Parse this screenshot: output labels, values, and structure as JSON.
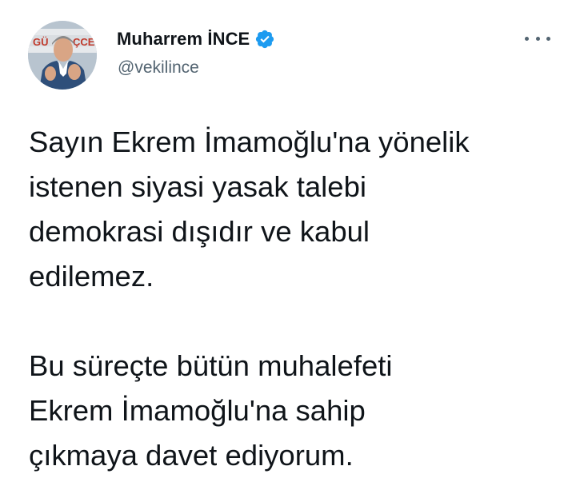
{
  "author": {
    "display_name": "Muharrem İNCE",
    "handle": "@vekilince",
    "verified": true,
    "avatar_banner_text": "GÜ ÇCE"
  },
  "icons": {
    "verified": "verified-badge-icon",
    "more": "more-options-icon"
  },
  "colors": {
    "verified_blue": "#1d9bf0",
    "text_primary": "#0f1419",
    "text_secondary": "#536471"
  },
  "tweet": {
    "paragraph_1": "Sayın Ekrem İmamoğlu'na yönelik\nistenen siyasi yasak talebi\ndemokrasi dışıdır ve kabul\nedilemez.",
    "paragraph_2": "Bu süreçte bütün muhalefeti\nEkrem İmamoğlu'na sahip\nçıkmaya davet ediyorum."
  }
}
